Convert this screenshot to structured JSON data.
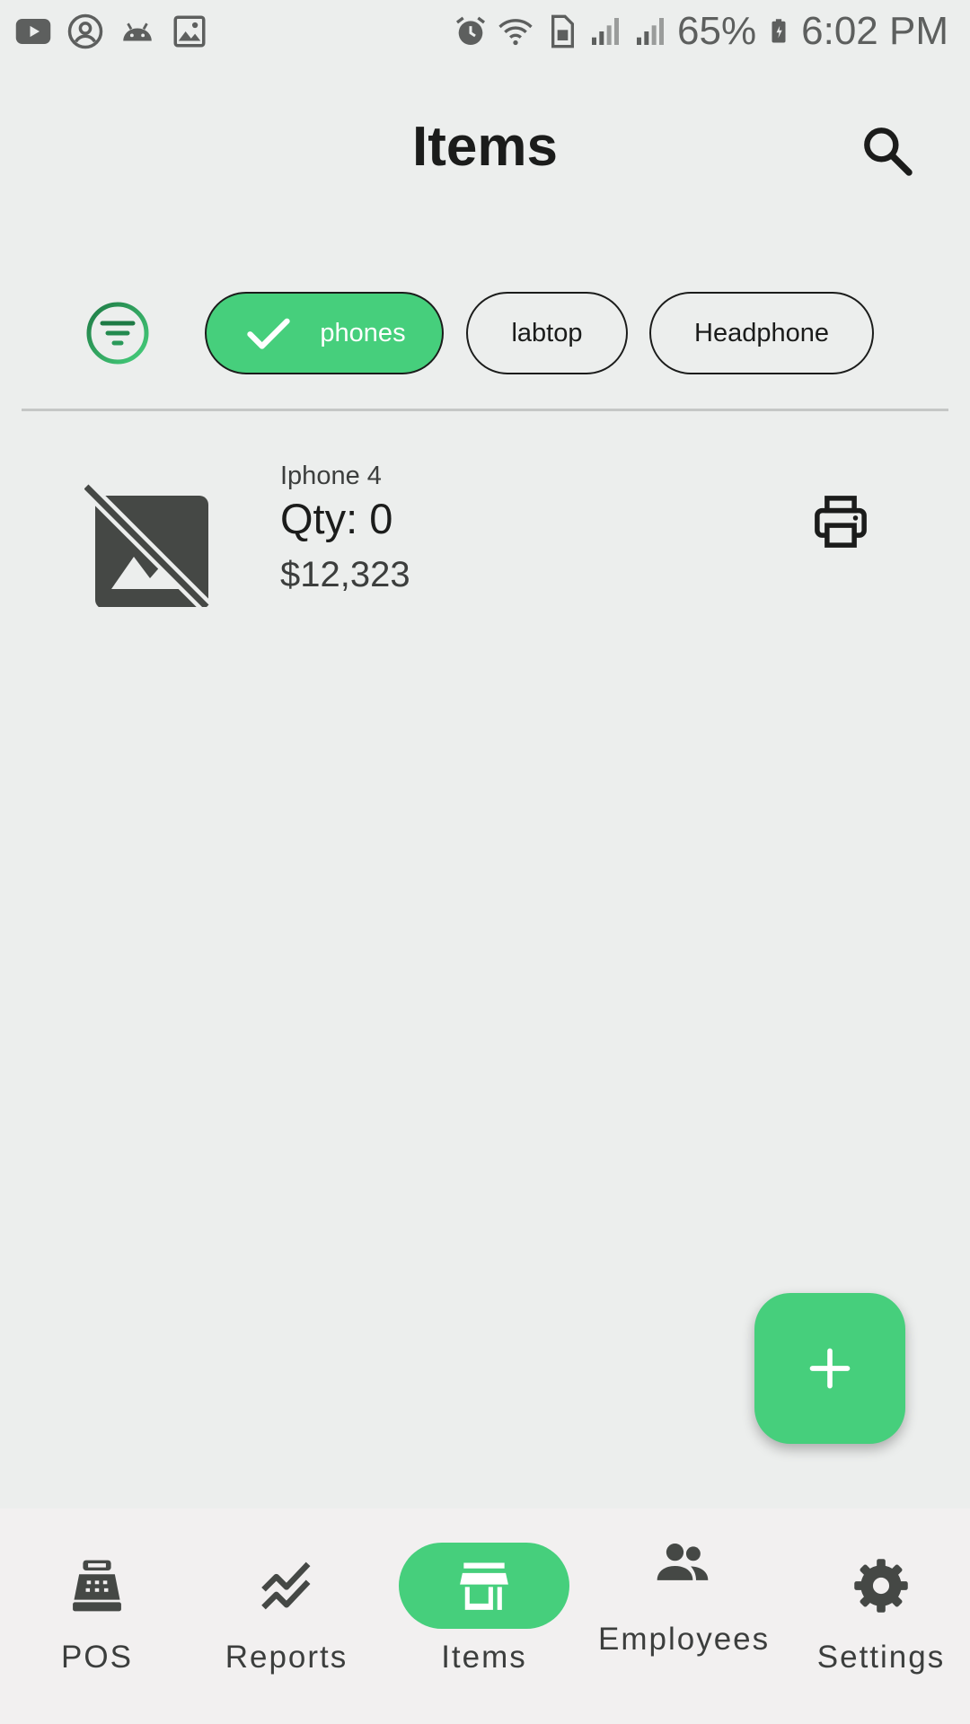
{
  "status_bar": {
    "battery_percent": "65%",
    "time": "6:02 PM",
    "left_icons": [
      "youtube-icon",
      "account-circle-icon",
      "android-icon",
      "image-icon"
    ],
    "right_icons": [
      "alarm-icon",
      "wifi-icon",
      "sim-icon",
      "signal-icon",
      "signal-icon",
      "battery-charging-icon"
    ]
  },
  "header": {
    "title": "Items",
    "search_icon": "search-icon"
  },
  "filters": {
    "filter_icon": "filter-icon",
    "chips": [
      {
        "label": "phones",
        "selected": true
      },
      {
        "label": "labtop",
        "selected": false
      },
      {
        "label": "Headphone",
        "selected": false
      }
    ]
  },
  "items": [
    {
      "name": "Iphone 4",
      "qty": "Qty: 0",
      "price": "$12,323",
      "image_icon": "no-image-icon",
      "action_icon": "print-icon"
    }
  ],
  "fab": {
    "icon": "add-icon"
  },
  "bottom_nav": {
    "items": [
      {
        "label": "POS",
        "icon": "cash-register-icon",
        "active": false
      },
      {
        "label": "Reports",
        "icon": "chart-line-icon",
        "active": false
      },
      {
        "label": "Items",
        "icon": "store-icon",
        "active": true
      },
      {
        "label": "Employees",
        "icon": "people-icon",
        "active": false
      },
      {
        "label": "Settings",
        "icon": "gear-icon",
        "active": false
      }
    ]
  },
  "colors": {
    "accent": "#46cf7c",
    "background": "#eceeed",
    "nav_background": "#f2f0f0",
    "text": "#1b1c1b",
    "icon_dark": "#454845"
  }
}
